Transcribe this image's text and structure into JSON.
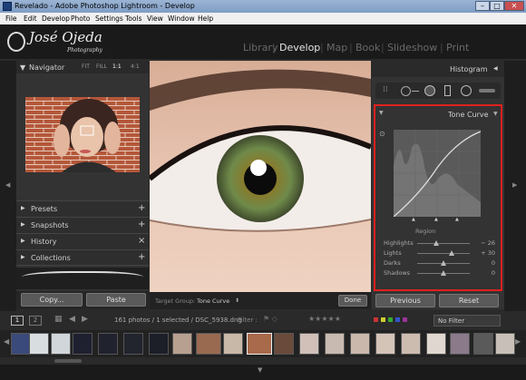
{
  "window": {
    "title": "Revelado - Adobe Photoshop Lightroom - Develop"
  },
  "menu": [
    "File",
    "Edit",
    "Develop",
    "Photo",
    "Settings",
    "Tools",
    "View",
    "Window",
    "Help"
  ],
  "identity": {
    "name": "José Ojeda",
    "tagline": "Photography"
  },
  "modules": [
    {
      "label": "Library",
      "active": false
    },
    {
      "label": "Develop",
      "active": true
    },
    {
      "label": "Map",
      "active": false
    },
    {
      "label": "Book",
      "active": false
    },
    {
      "label": "Slideshow",
      "active": false
    },
    {
      "label": "Print",
      "active": false
    }
  ],
  "navigator": {
    "title": "Navigator",
    "zoom": [
      "FIT",
      "FILL",
      "1:1",
      "4:1"
    ]
  },
  "left_sections": [
    {
      "label": "Presets",
      "action": "+"
    },
    {
      "label": "Snapshots",
      "action": "+"
    },
    {
      "label": "History",
      "action": "×"
    },
    {
      "label": "Collections",
      "action": "+"
    }
  ],
  "left_buttons": {
    "copy": "Copy...",
    "paste": "Paste"
  },
  "toolbar": {
    "target_label": "Target Group:",
    "target_value": "Tone Curve",
    "done": "Done"
  },
  "histogram": {
    "title": "Histogram"
  },
  "tone_curve": {
    "title": "Tone Curve",
    "region_label": "Region",
    "sliders": [
      {
        "label": "Highlights",
        "value": "− 26",
        "level": 0.37
      },
      {
        "label": "Lights",
        "value": "+ 30",
        "level": 0.65
      },
      {
        "label": "Darks",
        "value": "0",
        "level": 0.5
      },
      {
        "label": "Shadows",
        "value": "0",
        "level": 0.5
      }
    ]
  },
  "right_buttons": {
    "previous": "Previous",
    "reset": "Reset"
  },
  "filmstrip_bar": {
    "pages": [
      "1",
      "2"
    ],
    "info": "161 photos / 1 selected / DSC_5938.dng",
    "filter_label": "Filter :",
    "filter_value": "No Filter"
  },
  "colors": {
    "highlight_box": "#e0201e",
    "accent": "#e6e6e6"
  }
}
